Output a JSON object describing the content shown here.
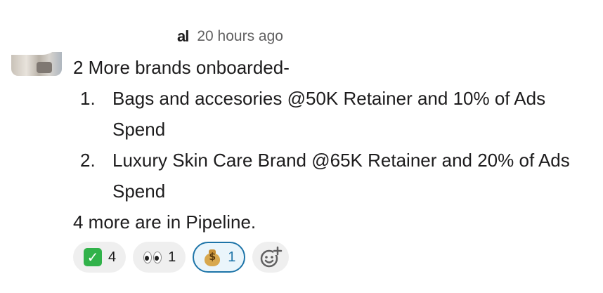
{
  "message": {
    "author_fragment": "al",
    "timestamp": "20 hours ago",
    "intro": "2 More brands onboarded-",
    "list": [
      {
        "number": "1.",
        "text": "Bags and accesories @50K Retainer and 10% of Ads Spend"
      },
      {
        "number": "2.",
        "text": "Luxury Skin Care Brand @65K Retainer and 20% of Ads Spend"
      }
    ],
    "outro": "4 more are in Pipeline."
  },
  "reactions": [
    {
      "emoji": "white-check-mark-icon",
      "count": "4",
      "selected": false
    },
    {
      "emoji": "eyes-icon",
      "count": "1",
      "selected": false
    },
    {
      "emoji": "moneybag-icon",
      "count": "1",
      "selected": true,
      "accent": "#1d74a8"
    }
  ],
  "add_reaction": {
    "icon": "add-emoji-icon"
  },
  "moneybag_sign": "$",
  "checkmark_glyph": "✓"
}
